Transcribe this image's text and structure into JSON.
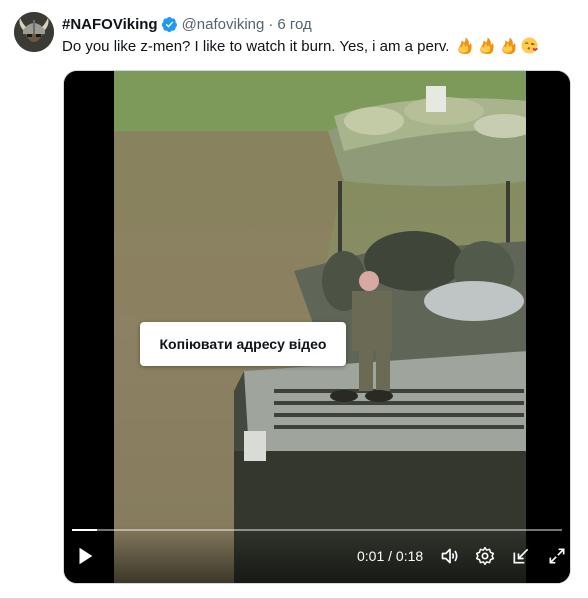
{
  "author": {
    "display_name": "#NAFOViking",
    "handle": "@nafoviking",
    "separator": "·",
    "time": "6 год"
  },
  "icons": {
    "avatar": "viking-helmet-avatar",
    "verified": "verified-badge-icon",
    "emoji_1": "fire-emoji",
    "emoji_2": "fire-emoji",
    "emoji_3": "fire-emoji",
    "emoji_4": "face-blowing-kiss-emoji"
  },
  "tweet": {
    "text": "Do you like z-men? I like to watch it burn. Yes, i am a perv."
  },
  "video": {
    "context_menu_item": "Копіювати адресу відео",
    "current_time": "0:01",
    "duration": "0:18",
    "time_separator": "/",
    "progress_fraction": 0.05
  },
  "colors": {
    "verified_blue": "#1d9bf0",
    "secondary_text": "#536471",
    "fire": "#f4900c",
    "kiss_face": "#ffcc4d"
  }
}
